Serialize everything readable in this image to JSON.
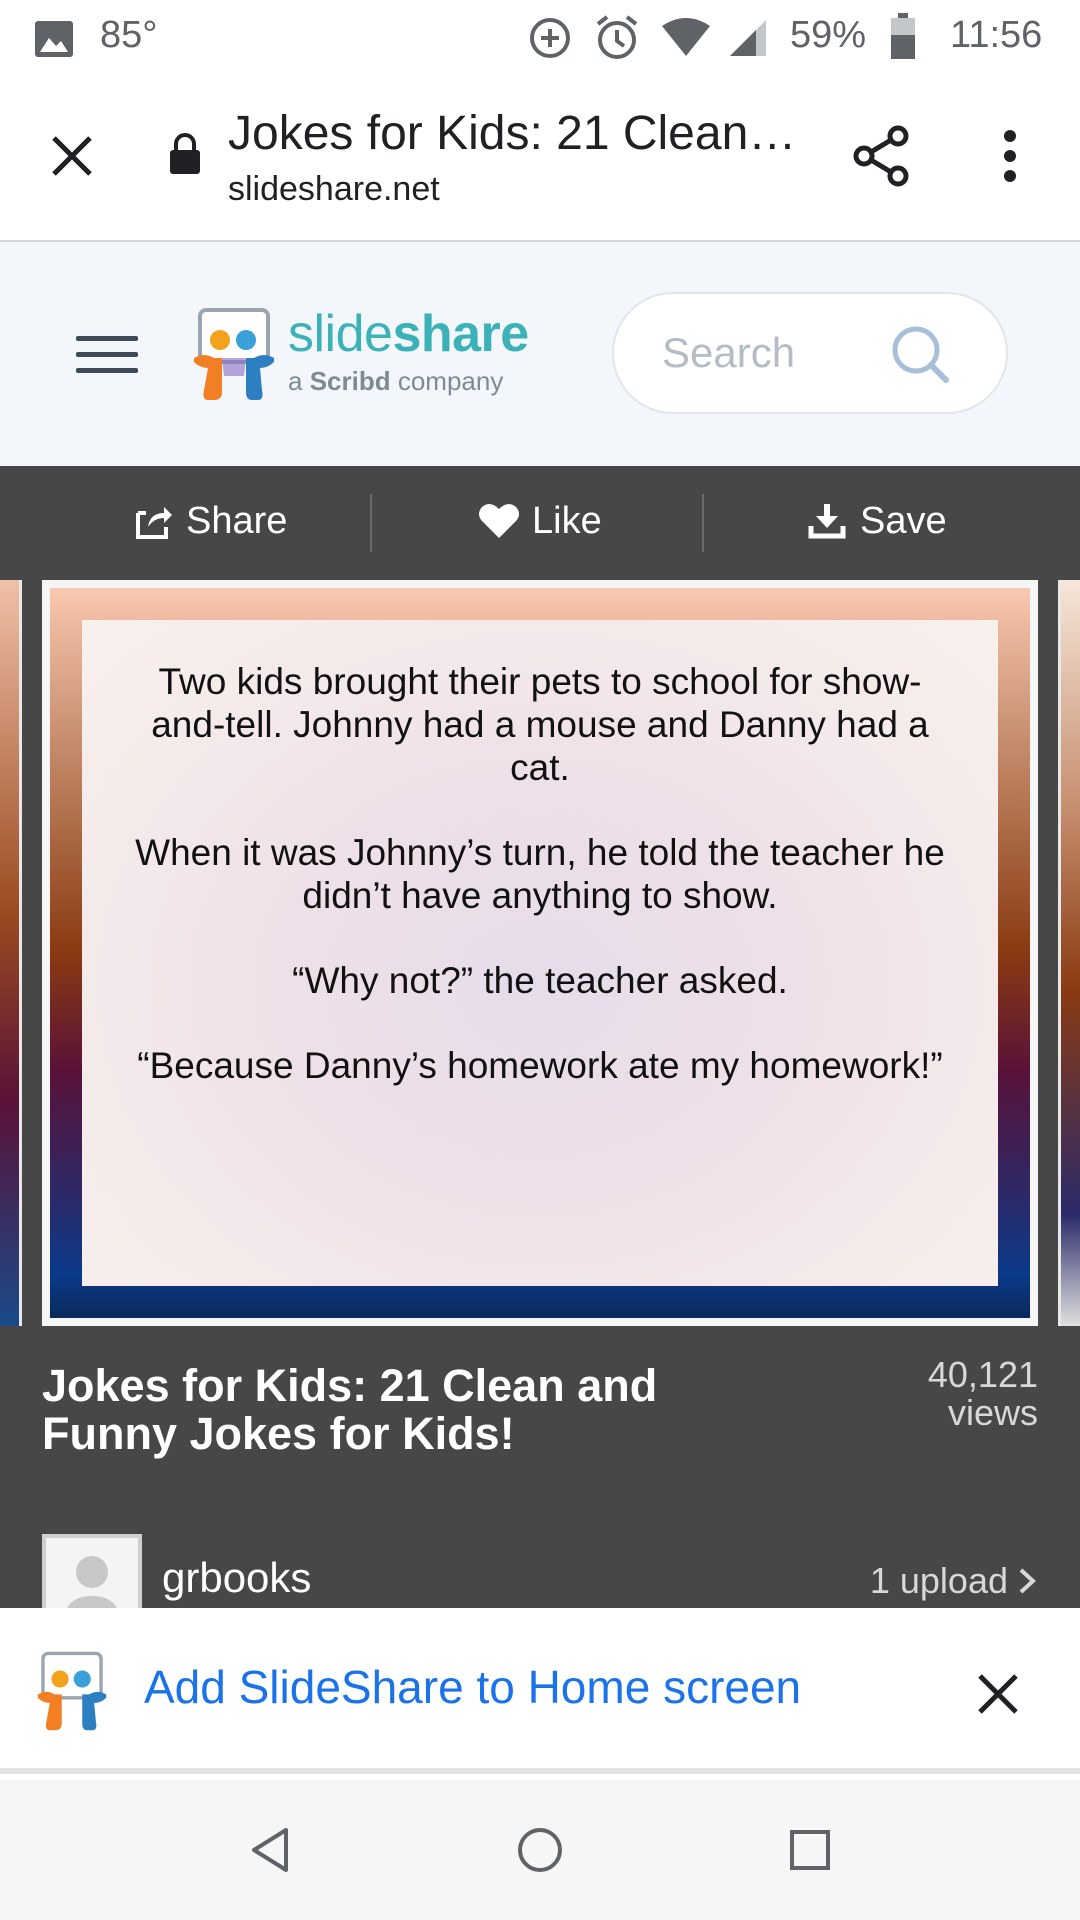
{
  "status_bar": {
    "temperature": "85°",
    "battery": "59%",
    "time": "11:56"
  },
  "browser": {
    "page_title": "Jokes for Kids: 21 Clean…",
    "domain": "slideshare.net"
  },
  "header": {
    "logo_name_light": "slide",
    "logo_name_bold": "share",
    "logo_subtitle_prefix": "a ",
    "logo_subtitle_brand": "Scribd",
    "logo_subtitle_suffix": " company",
    "search_placeholder": "Search"
  },
  "actions": {
    "share_label": "Share",
    "like_label": "Like",
    "save_label": "Save"
  },
  "slide": {
    "paragraphs": [
      "Two kids brought their pets to school for show-and-tell. Johnny had a mouse and Danny had a cat.",
      "When it was Johnny’s turn, he told the teacher he didn’t have anything to show.",
      "“Why not?” the teacher asked.",
      "“Because Danny’s homework ate my homework!”"
    ]
  },
  "presentation": {
    "title": "Jokes for Kids: 21 Clean and Funny Jokes for Kids!",
    "views_number": "40,121",
    "views_label": "views",
    "uploader": "grbooks",
    "upload_count": "1 upload"
  },
  "install_banner": {
    "text": "Add SlideShare to Home screen"
  },
  "colors": {
    "accent_blue": "#1a73e8",
    "slideshare_teal": "#3bb2b8",
    "dark_panel": "#474747",
    "header_bg": "#f3f6fa"
  }
}
